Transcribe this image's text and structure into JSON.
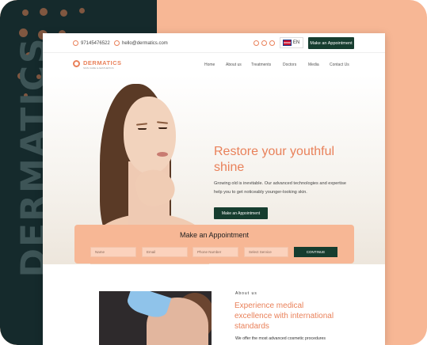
{
  "brand_word": "DERMATICS",
  "topbar": {
    "phone": "97145476522",
    "email": "hello@dermatics.com",
    "language": "EN",
    "cta": "Make an Appointment"
  },
  "logo": {
    "name": "DERMATICS",
    "tagline": "SKIN CARE & AESTHETICS"
  },
  "nav": [
    "Home",
    "About us",
    "Treatments",
    "Doctors",
    "Media",
    "Contact Us"
  ],
  "hero": {
    "title": "Restore your youthful shine",
    "text": "Growing old is inevitable. Our advanced technologies and expertise help you to get noticeably younger-looking skin.",
    "cta": "Make an Appointment",
    "prev": "←",
    "next": "→"
  },
  "appointment": {
    "title": "Make an Appointment",
    "name_placeholder": "Name",
    "email_placeholder": "Email",
    "phone_placeholder": "Phone Number",
    "service_placeholder": "Select Service",
    "submit": "CONTINUE"
  },
  "about": {
    "kicker": "About us",
    "title": "Experience medical excellence with international standards",
    "text": "We offer the most advanced cosmetic procedures"
  },
  "colors": {
    "accent": "#e9815a",
    "dark_green": "#163d2f",
    "peach": "#f7b795",
    "navy": "#152a2c"
  }
}
